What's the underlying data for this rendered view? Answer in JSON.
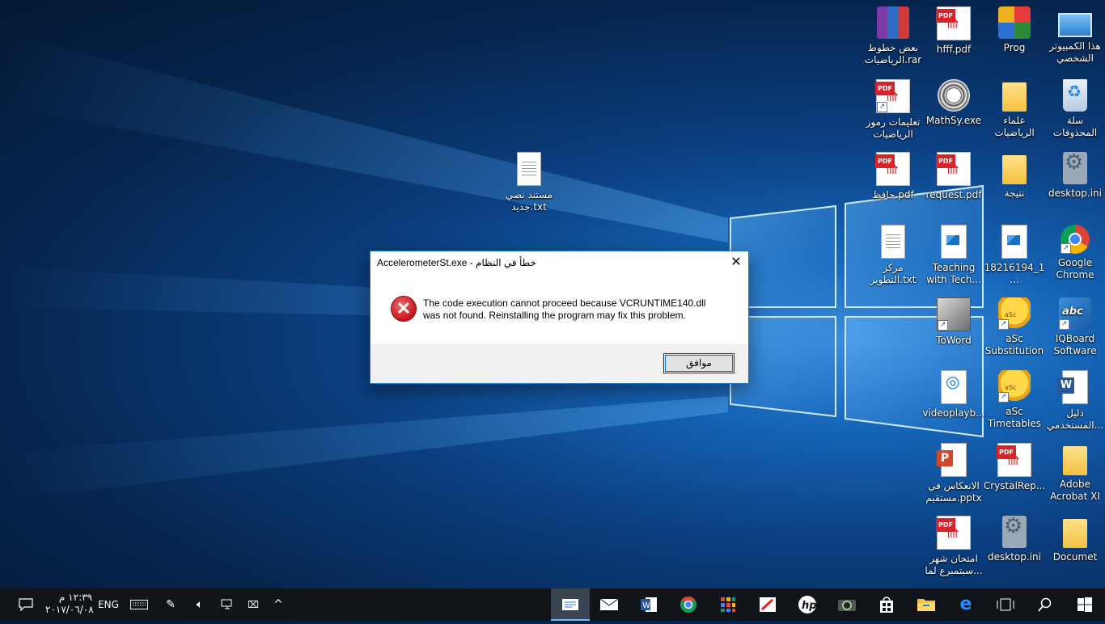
{
  "desktop_icons": {
    "pc": "هذا الكمبيوتر الشخصي",
    "prog": "Prog",
    "hfff": "hfff.pdf",
    "rar": "بعض خطوط الرياضيات.rar",
    "recycle": "سلة المحذوفات",
    "ulama": "علماء الرياضيات",
    "mathsy": "MathSy.exe",
    "taalimat": "تعليمات رموز الرياضيات",
    "desktopini1": "desktop.ini",
    "natija": "نتيجة",
    "request": "request.pdf",
    "hafez": "حافظ.pdf",
    "chrome": "Google Chrome",
    "img18216194": "18216194_1...",
    "teaching": "Teaching with Tech...",
    "markaz": "مركز التطوير.txt",
    "iqboard": "IQBoard Software",
    "asc_sub": "aSc Substitution",
    "toword": "ToWord",
    "dalil": "دليل المستخدمي...",
    "asc_time": "aSc Timetables",
    "videoplay": "videoplayb...",
    "adobe": "Adobe Acrobat XI",
    "crystal": "CrystalRep...",
    "inikas": "الانعكاس في مستقيم.pptx",
    "documet": "Documet",
    "desktopini2": "desktop.ini",
    "imtihan": "امتحان شهر سبتمبرع لما...",
    "new_txt": "مستند نصي جديد.txt"
  },
  "dialog": {
    "title": "AccelerometerSt.exe - خطأ في النظام",
    "message": "The code execution cannot proceed because VCRUNTIME140.dll was not found. Reinstalling the program may fix this problem.",
    "ok_label": "موافق",
    "close_glyph": "✕",
    "error_glyph": "✕"
  },
  "taskbar": {
    "language": "ENG",
    "time": "١٢:٣٩ م",
    "date": "٢٠١٧/٠٦/٠٨",
    "apps": [
      "notepad-icon",
      "mail-icon",
      "word-icon",
      "chrome-icon",
      "apps-grid-icon",
      "red-app-icon",
      "hp-icon",
      "camera-icon",
      "store-icon",
      "file-explorer-icon",
      "edge-icon",
      "task-view-icon",
      "search-icon",
      "start-icon"
    ]
  },
  "colors": {
    "accent": "#1979ca",
    "taskbar": "#101418",
    "error_red": "#c4161c"
  }
}
